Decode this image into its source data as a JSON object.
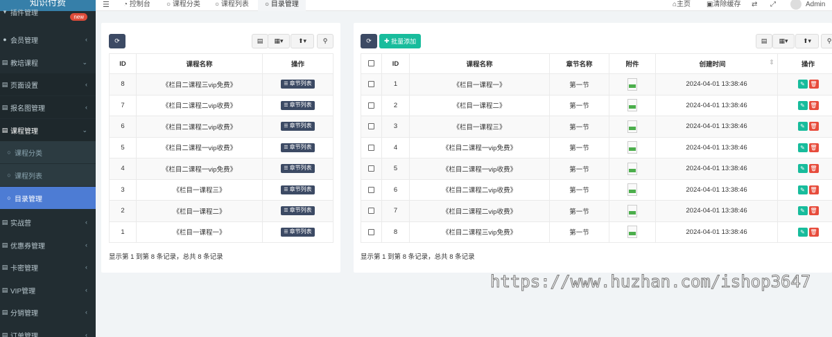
{
  "app": {
    "logo": "知识付费"
  },
  "sidebar": {
    "items": [
      {
        "label": "插件管理",
        "badge": "new"
      },
      {
        "label": "会员管理"
      },
      {
        "label": "教培课程"
      },
      {
        "label": "页面设置"
      },
      {
        "label": "报名图管理"
      },
      {
        "label": "课程管理"
      },
      {
        "label": "课程分类"
      },
      {
        "label": "课程列表"
      },
      {
        "label": "目录管理"
      },
      {
        "label": "实战营"
      },
      {
        "label": "优惠券管理"
      },
      {
        "label": "卡密管理"
      },
      {
        "label": "VIP管理"
      },
      {
        "label": "分销管理"
      },
      {
        "label": "订单管理"
      }
    ]
  },
  "topbar": {
    "tabs": [
      "控制台",
      "课程分类",
      "课程列表",
      "目录管理"
    ],
    "home": "主页",
    "clear_cache": "清除缓存",
    "user": "Admin"
  },
  "left_table": {
    "headers": [
      "ID",
      "课程名称",
      "操作"
    ],
    "action_label": "章节列表",
    "rows": [
      {
        "id": "8",
        "name": "《栏目二课程三vip免费》"
      },
      {
        "id": "7",
        "name": "《栏目二课程二vip收费》"
      },
      {
        "id": "6",
        "name": "《栏目二课程二vip收费》"
      },
      {
        "id": "5",
        "name": "《栏目二课程一vip收费》"
      },
      {
        "id": "4",
        "name": "《栏目二课程一vip免费》"
      },
      {
        "id": "3",
        "name": "《栏目一课程三》"
      },
      {
        "id": "2",
        "name": "《栏目一课程二》"
      },
      {
        "id": "1",
        "name": "《栏目一课程一》"
      }
    ],
    "footer": "显示第 1 到第 8 条记录，总共 8 条记录"
  },
  "right_table": {
    "add_button": "批量添加",
    "headers": [
      "ID",
      "课程名称",
      "章节名称",
      "附件",
      "创建时间",
      "操作"
    ],
    "rows": [
      {
        "id": "1",
        "course": "《栏目一课程一》",
        "chapter": "第一节",
        "created": "2024-04-01 13:38:46"
      },
      {
        "id": "2",
        "course": "《栏目一课程二》",
        "chapter": "第一节",
        "created": "2024-04-01 13:38:46"
      },
      {
        "id": "3",
        "course": "《栏目一课程三》",
        "chapter": "第一节",
        "created": "2024-04-01 13:38:46"
      },
      {
        "id": "4",
        "course": "《栏目二课程一vip免费》",
        "chapter": "第一节",
        "created": "2024-04-01 13:38:46"
      },
      {
        "id": "5",
        "course": "《栏目二课程一vip收费》",
        "chapter": "第一节",
        "created": "2024-04-01 13:38:46"
      },
      {
        "id": "6",
        "course": "《栏目二课程二vip收费》",
        "chapter": "第一节",
        "created": "2024-04-01 13:38:46"
      },
      {
        "id": "7",
        "course": "《栏目二课程二vip收费》",
        "chapter": "第一节",
        "created": "2024-04-01 13:38:46"
      },
      {
        "id": "8",
        "course": "《栏目二课程三vip免费》",
        "chapter": "第一节",
        "created": "2024-04-01 13:38:46"
      }
    ],
    "footer": "显示第 1 到第 8 条记录，总共 8 条记录"
  },
  "watermark": "https://www.huzhan.com/ishop3647",
  "colors": {
    "sidebar": "#222d32",
    "active": "#4d7cd4",
    "dark_button": "#3c4a64",
    "green": "#18bc9c",
    "red": "#e74c3c"
  }
}
